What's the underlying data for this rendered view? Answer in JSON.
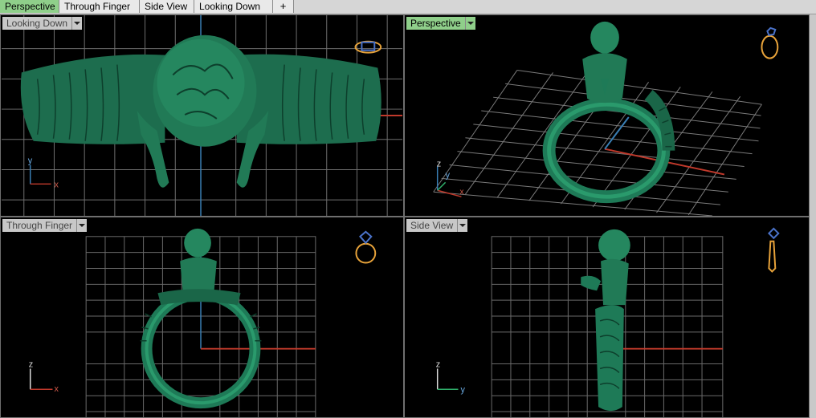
{
  "tabs": [
    {
      "label": "Perspective",
      "active": true
    },
    {
      "label": "Through Finger",
      "active": false
    },
    {
      "label": "Side View",
      "active": false
    },
    {
      "label": "Looking Down",
      "active": false
    }
  ],
  "tab_add_label": "+",
  "viewports": {
    "looking_down": {
      "title": "Looking Down",
      "axis_x": "x",
      "axis_y": "y",
      "active": false
    },
    "perspective": {
      "title": "Perspective",
      "axis_z": "z",
      "axis_y": "y",
      "axis_x": "x",
      "active": true
    },
    "through_finger": {
      "title": "Through Finger",
      "axis_z": "z",
      "axis_x": "x",
      "active": false
    },
    "side_view": {
      "title": "Side View",
      "axis_z": "z",
      "axis_y": "y",
      "active": false
    }
  },
  "colors": {
    "model": "#1e7a57",
    "grid": "#7a7a7a",
    "axis_red": "#c0392b",
    "axis_blue": "#3a7fb5",
    "active_tab": "#8fcf8a",
    "widget": "#e8a33a"
  },
  "icons": {
    "looking_down": "ring-top-view-icon",
    "perspective": "ring-perspective-icon",
    "through_finger": "ring-front-view-icon",
    "side_view": "ring-side-view-icon"
  }
}
